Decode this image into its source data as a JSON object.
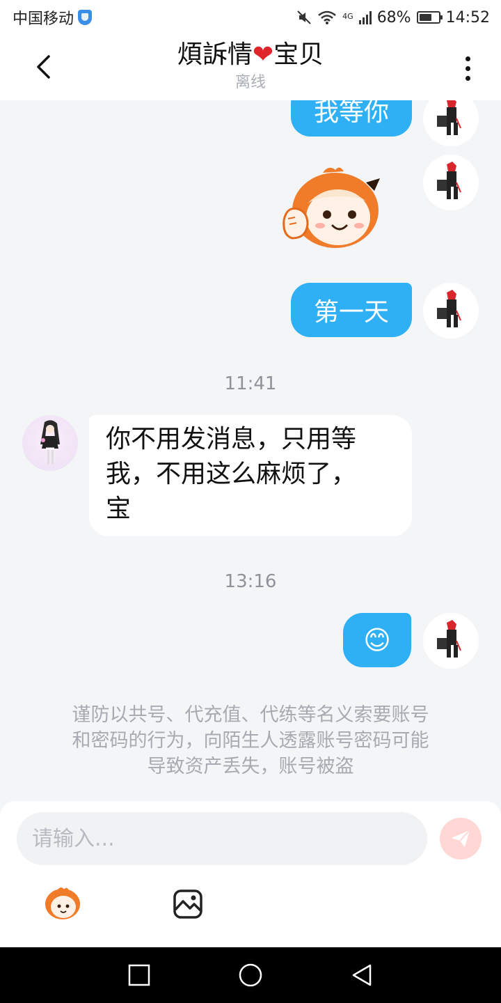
{
  "status_bar": {
    "carrier": "中国移动",
    "network": "4G",
    "battery": "68%",
    "battery_level": 0.68,
    "time": "14:52"
  },
  "header": {
    "title_part1": "煩訴情",
    "title_heart": "❤",
    "title_part2": "宝贝",
    "status": "离线"
  },
  "messages": [
    {
      "side": "out",
      "type": "text",
      "text": "我等你"
    },
    {
      "side": "out",
      "type": "sticker",
      "sticker": "waving-girl-sticker"
    },
    {
      "side": "out",
      "type": "text",
      "text": "第一天"
    },
    {
      "type": "time",
      "text": "11:41"
    },
    {
      "side": "in",
      "type": "text",
      "lines": [
        "你不用发消息，只用等",
        "我，不用这么麻烦了，",
        "宝"
      ]
    },
    {
      "type": "time",
      "text": "13:16"
    },
    {
      "side": "out",
      "type": "emoji",
      "text": "😊"
    }
  ],
  "notice": {
    "lines": [
      "谨防以共号、代充值、代练等名义索要账号",
      "和密码的行为，向陌生人透露账号密码可能",
      "导致资产丢失，账号被盗"
    ]
  },
  "composer": {
    "placeholder": "请输入...",
    "tools": [
      "sticker-icon",
      "image-icon"
    ]
  },
  "colors": {
    "outgoing_bubble": "#2fb0f5",
    "incoming_bubble": "#ffffff",
    "background": "#f4f5f7",
    "send_button": "#ffd7d4",
    "heart": "#e0262b"
  }
}
